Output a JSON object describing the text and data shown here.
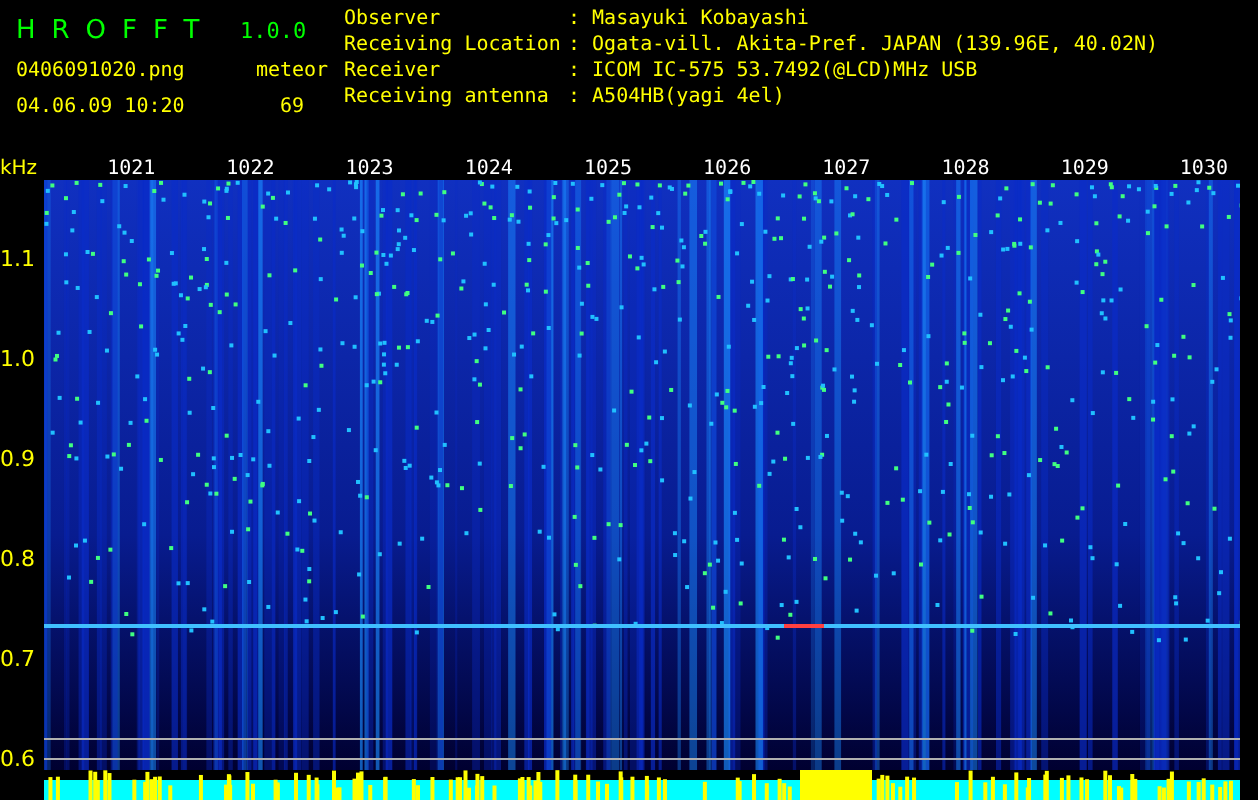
{
  "header": {
    "app_title": "HROFFT",
    "version": "1.0.0",
    "file_name": "0406091020.png",
    "date_time": "04.06.09 10:20",
    "meteor_label": "meteor",
    "meteor_count": "69"
  },
  "info": [
    {
      "label": "Observer",
      "value": ": Masayuki Kobayashi"
    },
    {
      "label": "Receiving Location",
      "value": ": Ogata-vill. Akita-Pref. JAPAN (139.96E, 40.02N)"
    },
    {
      "label": "Receiver",
      "value": ": ICOM IC-575 53.7492(@LCD)MHz USB"
    },
    {
      "label": "Receiving antenna",
      "value": ": A504HB(yagi 4el)"
    }
  ],
  "time_axis": {
    "unit": "kHz",
    "labels": [
      "1021",
      "1022",
      "1023",
      "1024",
      "1025",
      "1026",
      "1027",
      "1028",
      "1029",
      "1030"
    ]
  },
  "freq_axis": {
    "labels": [
      "1.1",
      "1.0",
      "0.9",
      "0.8",
      "0.7",
      "0.6"
    ]
  }
}
